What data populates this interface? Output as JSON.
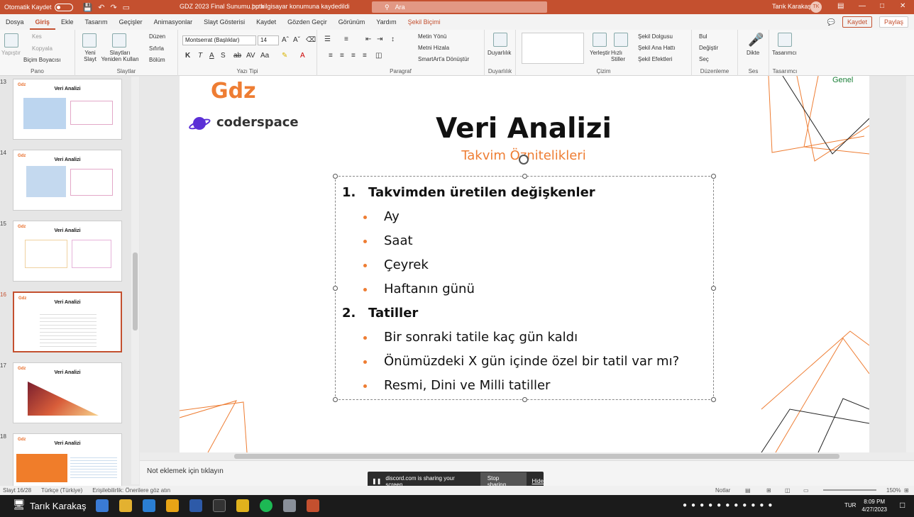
{
  "titlebar": {
    "autosave": "Otomatik Kaydet",
    "doc_title": "GDZ 2023 Final Sunumu.pptx",
    "save_status": "bu bilgisayar konumuna kaydedildi",
    "search_placeholder": "Ara",
    "user": "Tarık Karakaş",
    "user_initials": "TK"
  },
  "tabs": [
    "Dosya",
    "Giriş",
    "Ekle",
    "Tasarım",
    "Geçişler",
    "Animasyonlar",
    "Slayt Gösterisi",
    "Kaydet",
    "Gözden Geçir",
    "Görünüm",
    "Yardım",
    "Şekil Biçimi"
  ],
  "tabs_right": {
    "record": "Kaydet",
    "share": "Paylaş"
  },
  "ribbon": {
    "pano": {
      "label": "Pano",
      "paste": "Yapıştır",
      "cut": "Kes",
      "copy": "Kopyala",
      "format_painter": "Biçim Boyacısı"
    },
    "slides": {
      "label": "Slaytlar",
      "new": "Yeni Slayt",
      "reuse": "Slaytları Yeniden Kullan",
      "layout": "Düzen",
      "reset": "Sıfırla",
      "section": "Bölüm"
    },
    "font": {
      "label": "Yazı Tipi",
      "font_name": "Montserrat (Başlıklar)",
      "font_size": "14",
      "bold": "K",
      "italic": "T",
      "underline": "A",
      "shadow": "S"
    },
    "paragraph": {
      "label": "Paragraf",
      "text_dir": "Metin Yönü",
      "align_text": "Metni Hizala",
      "smartart": "SmartArt'a Dönüştür"
    },
    "sensitivity": {
      "label": "Duyarlılık",
      "button": "Duyarlılık"
    },
    "drawing": {
      "label": "Çizim",
      "arrange": "Yerleştir",
      "quick_styles": "Hızlı Stiller",
      "fill": "Şekil Dolgusu",
      "outline": "Şekil Ana Hattı",
      "effects": "Şekil Efektleri"
    },
    "editing": {
      "label": "Düzenleme",
      "find": "Bul",
      "replace": "Değiştir",
      "select": "Seç"
    },
    "voice": {
      "label": "Ses",
      "dictate": "Dikte"
    },
    "designer": {
      "label": "Tasarımcı",
      "button": "Tasarımcı"
    }
  },
  "thumbnails": [
    {
      "num": "13",
      "title": "Veri Analizi"
    },
    {
      "num": "14",
      "title": "Veri Analizi"
    },
    {
      "num": "15",
      "title": "Veri Analizi"
    },
    {
      "num": "16",
      "title": "Veri Analizi"
    },
    {
      "num": "17",
      "title": "Veri Analizi"
    },
    {
      "num": "18",
      "title": "Veri Analizi"
    }
  ],
  "slide": {
    "label": "Genel",
    "logo_gdz": "Gdz",
    "logo_coder": "coderspace",
    "title": "Veri Analizi",
    "subtitle": "Takvim Öznitelikleri",
    "items": [
      {
        "marker": "1.",
        "text": "Takvimden üretilen değişkenler",
        "level": 0
      },
      {
        "text": "Ay",
        "level": 1
      },
      {
        "text": "Saat",
        "level": 1
      },
      {
        "text": "Çeyrek",
        "level": 1
      },
      {
        "text": "Haftanın günü",
        "level": 1
      },
      {
        "marker": "2.",
        "text": "Tatiller",
        "level": 0
      },
      {
        "text": "Bir sonraki tatile kaç gün kaldı",
        "level": 1
      },
      {
        "text": "Önümüzdeki X gün içinde özel bir tatil var mı?",
        "level": 1
      },
      {
        "text": "Resmi, Dini ve Milli tatiller",
        "level": 1
      }
    ]
  },
  "notes_placeholder": "Not eklemek için tıklayın",
  "discord": {
    "message": "discord.com is sharing your screen.",
    "stop": "Stop sharing",
    "hide": "Hide"
  },
  "status": {
    "slide": "Slayt 16/28",
    "language": "Türkçe (Türkiye)",
    "accessibility": "Erişilebilirlik: Önerilere göz atın",
    "notes": "Notlar",
    "zoom": "150%"
  },
  "taskbar": {
    "user": "Tarık Karakaş",
    "lang": "TUR",
    "time": "8:09 PM",
    "date": "4/27/2023"
  }
}
